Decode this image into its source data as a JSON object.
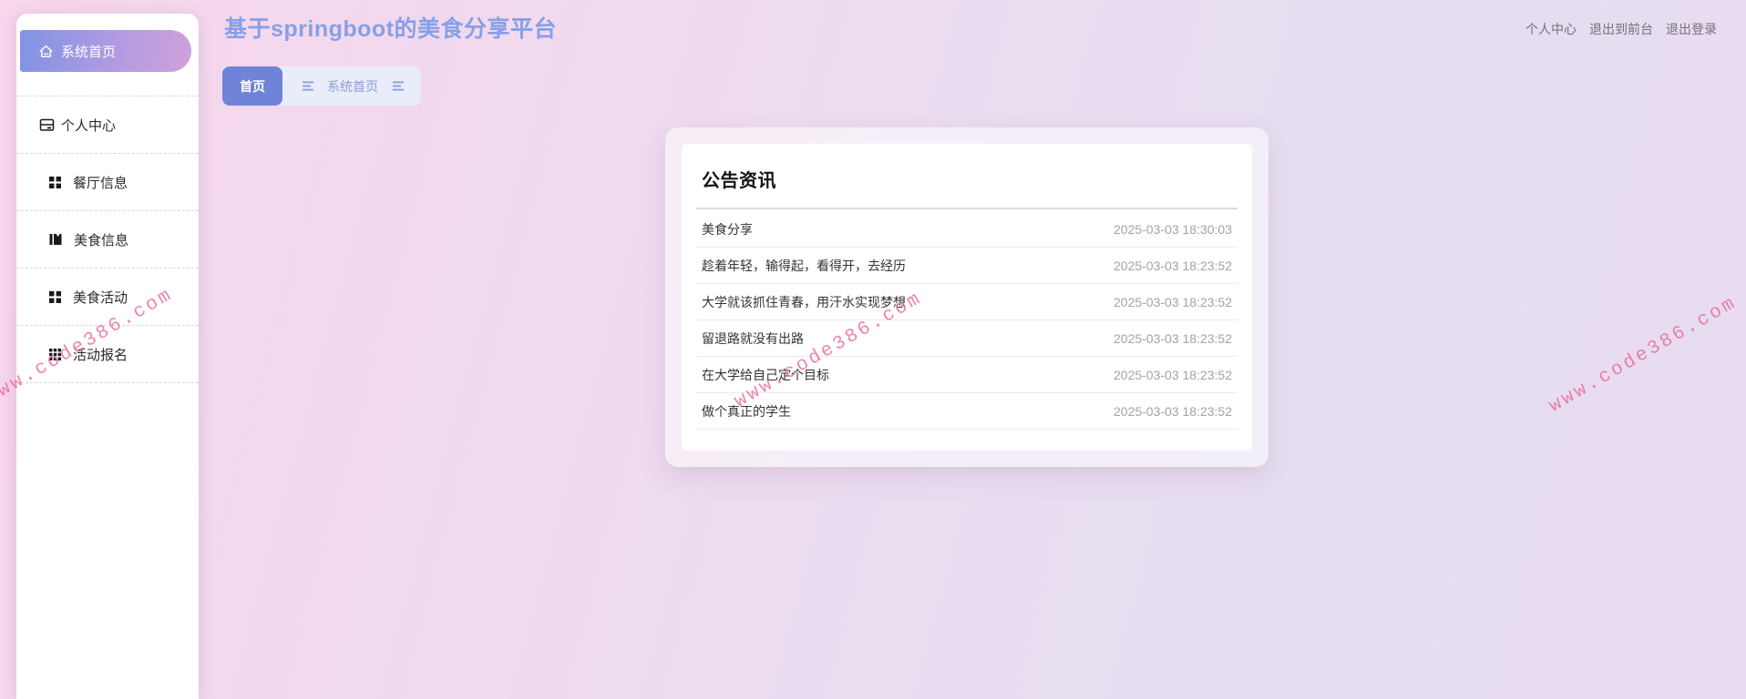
{
  "header": {
    "title": "基于springboot的美食分享平台",
    "nav_links": [
      {
        "label": "个人中心"
      },
      {
        "label": "退出到前台"
      },
      {
        "label": "退出登录"
      }
    ]
  },
  "sidebar": {
    "active_item": {
      "label": "系统首页",
      "icon": "home-icon"
    },
    "items": [
      {
        "label": "个人中心",
        "icon": "window-icon"
      },
      {
        "label": "餐厅信息",
        "icon": "grid4-icon"
      },
      {
        "label": "美食信息",
        "icon": "book-icon"
      },
      {
        "label": "美食活动",
        "icon": "grid4-icon"
      },
      {
        "label": "活动报名",
        "icon": "grid9-icon"
      }
    ]
  },
  "tabs": {
    "active_tab": "首页",
    "breadcrumb": "系统首页"
  },
  "announcements": {
    "title": "公告资讯",
    "items": [
      {
        "text": "美食分享",
        "time": "2025-03-03 18:30:03"
      },
      {
        "text": "趁着年轻，输得起，看得开，去经历",
        "time": "2025-03-03 18:23:52"
      },
      {
        "text": "大学就该抓住青春，用汗水实现梦想",
        "time": "2025-03-03 18:23:52"
      },
      {
        "text": "留退路就没有出路",
        "time": "2025-03-03 18:23:52"
      },
      {
        "text": "在大学给自己定个目标",
        "time": "2025-03-03 18:23:52"
      },
      {
        "text": "做个真正的学生",
        "time": "2025-03-03 18:23:52"
      }
    ]
  },
  "watermark": {
    "text": "www.code386.com"
  },
  "colors": {
    "accent_blue": "#6f84d8",
    "sidebar_gradient_start": "#8093e4",
    "sidebar_gradient_end": "#d0a2da",
    "title_blue": "#86a0e8",
    "watermark_pink": "#e9699e",
    "bg_pink": "#f8d6ec",
    "bg_lavender": "#e5def0"
  }
}
